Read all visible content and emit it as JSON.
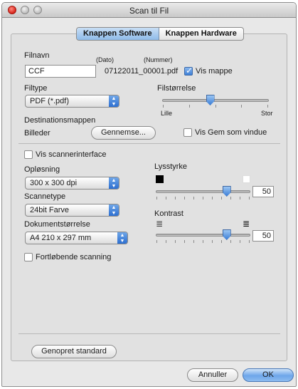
{
  "window": {
    "title": "Scan til Fil"
  },
  "tabs": [
    {
      "label": "Knappen Software",
      "active": true
    },
    {
      "label": "Knappen Hardware",
      "active": false
    }
  ],
  "file": {
    "filename_label": "Filnavn",
    "date_label": "(Dato)",
    "number_label": "(Nummer)",
    "filename_value": "CCF",
    "filename_suffix": "07122011_00001.pdf",
    "show_folder_label": "Vis mappe",
    "show_folder_checked": true
  },
  "filetype": {
    "label": "Filtype",
    "selected": "PDF (*.pdf)"
  },
  "filesize": {
    "label": "Filstørrelse",
    "min_label": "Lille",
    "max_label": "Stor",
    "level": 0.45
  },
  "destination": {
    "label": "Destinationsmappen",
    "folder_value": "Billeder",
    "browse_label": "Gennemse...",
    "show_save_window_label": "Vis Gem som vindue",
    "show_save_window_checked": false
  },
  "scanner_interface": {
    "label": "Vis scannerinterface",
    "checked": false
  },
  "resolution": {
    "label": "Opløsning",
    "selected": "300 x 300 dpi"
  },
  "scan_type": {
    "label": "Scannetype",
    "selected": "24bit Farve"
  },
  "document_size": {
    "label": "Dokumentstørrelse",
    "selected": "A4 210 x 297 mm"
  },
  "continuous_scan": {
    "label": "Fortløbende scanning",
    "checked": false
  },
  "brightness": {
    "label": "Lysstyrke",
    "value": "50"
  },
  "contrast": {
    "label": "Kontrast",
    "value": "50"
  },
  "buttons": {
    "restore_default": "Genopret standard",
    "cancel": "Annuller",
    "ok": "OK"
  },
  "colors": {
    "accent": "#3d7fd6",
    "close": "#d8241a"
  }
}
